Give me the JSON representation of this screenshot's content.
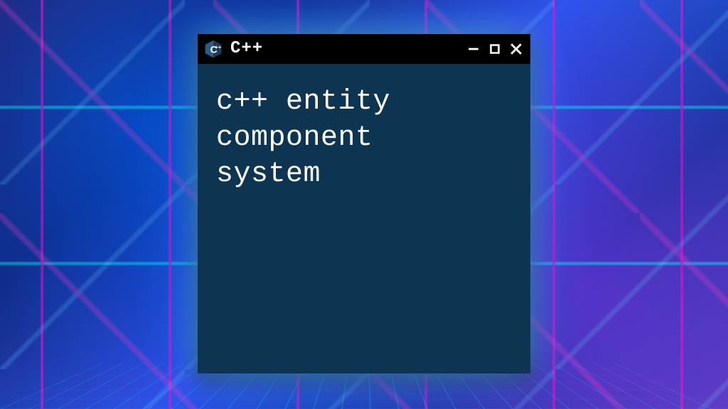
{
  "window": {
    "title": "C++",
    "icon_name": "cpp-logo",
    "controls": {
      "minimize": "minimize",
      "maximize": "maximize",
      "close": "close"
    }
  },
  "content": {
    "text": "c++ entity\ncomponent\nsystem"
  },
  "colors": {
    "titlebar_bg": "#000000",
    "client_bg": "#0d3552",
    "text": "#ffffff",
    "glow": "#64c8ff"
  }
}
